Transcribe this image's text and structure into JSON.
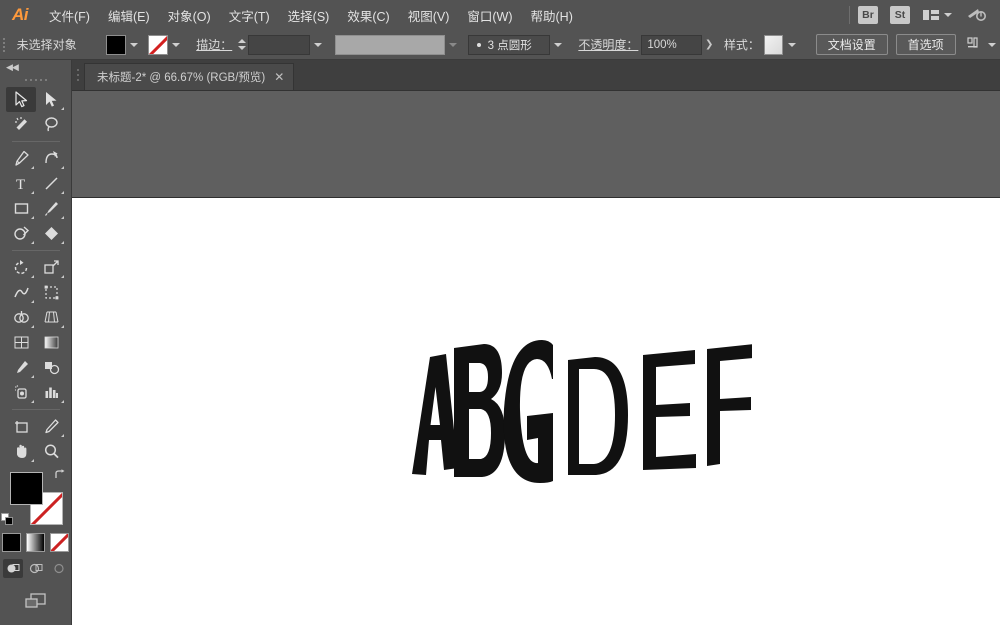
{
  "app": {
    "name": "Adobe Illustrator",
    "logo_text": "Ai"
  },
  "menubar": {
    "items": [
      {
        "label": "文件(F)"
      },
      {
        "label": "编辑(E)"
      },
      {
        "label": "对象(O)"
      },
      {
        "label": "文字(T)"
      },
      {
        "label": "选择(S)"
      },
      {
        "label": "效果(C)"
      },
      {
        "label": "视图(V)"
      },
      {
        "label": "窗口(W)"
      },
      {
        "label": "帮助(H)"
      }
    ],
    "bridge_badge": "Br",
    "stock_badge": "St",
    "workspace_icon": "workspace-switcher-icon",
    "search_icon": "search-adobe-icon"
  },
  "controlbar": {
    "selection_status": "未选择对象",
    "fill_swatch_color": "#000000",
    "stroke_swatch_label": "无",
    "stroke_label": "描边：",
    "stroke_weight_value": "",
    "brush_definition_value": "",
    "brush_profile_label": "3 点圆形",
    "opacity_label": "不透明度：",
    "opacity_value": "100%",
    "style_label": "样式：",
    "document_setup_button": "文档设置",
    "preferences_button": "首选项",
    "align_icon": "align-objects-icon"
  },
  "tabbar": {
    "tabs": [
      {
        "title": "未标题-2* @ 66.67% (RGB/预览)",
        "close": "✕",
        "active": true
      }
    ]
  },
  "toolbar": {
    "collapse_label": "◀◀",
    "tools": [
      {
        "name": "selection-tool",
        "label": "选择工具",
        "active": true,
        "has_flyout": false
      },
      {
        "name": "direct-selection-tool",
        "label": "直接选择工具",
        "active": false,
        "has_flyout": true
      },
      {
        "name": "magic-wand-tool",
        "label": "魔棒工具",
        "active": false,
        "has_flyout": false
      },
      {
        "name": "lasso-tool",
        "label": "套索工具",
        "active": false,
        "has_flyout": false
      },
      {
        "name": "pen-tool",
        "label": "钢笔工具",
        "active": false,
        "has_flyout": true
      },
      {
        "name": "curvature-tool",
        "label": "曲率工具",
        "active": false,
        "has_flyout": true
      },
      {
        "name": "type-tool",
        "label": "文字工具",
        "active": false,
        "has_flyout": true
      },
      {
        "name": "line-segment-tool",
        "label": "直线段工具",
        "active": false,
        "has_flyout": true
      },
      {
        "name": "rectangle-tool",
        "label": "矩形工具",
        "active": false,
        "has_flyout": true
      },
      {
        "name": "paintbrush-tool",
        "label": "画笔工具",
        "active": false,
        "has_flyout": true
      },
      {
        "name": "shaper-pencil-tool",
        "label": "Shaper 工具",
        "active": false,
        "has_flyout": true
      },
      {
        "name": "eraser-tool",
        "label": "橡皮擦工具",
        "active": false,
        "has_flyout": true
      },
      {
        "name": "rotate-tool",
        "label": "旋转工具",
        "active": false,
        "has_flyout": true
      },
      {
        "name": "scale-tool",
        "label": "比例缩放工具",
        "active": false,
        "has_flyout": true
      },
      {
        "name": "width-tool",
        "label": "宽度工具",
        "active": false,
        "has_flyout": true
      },
      {
        "name": "free-transform-tool",
        "label": "自由变换工具",
        "active": false,
        "has_flyout": false
      },
      {
        "name": "shape-builder-tool",
        "label": "形状生成器工具",
        "active": false,
        "has_flyout": true
      },
      {
        "name": "perspective-grid-tool",
        "label": "透视网格工具",
        "active": false,
        "has_flyout": true
      },
      {
        "name": "mesh-tool",
        "label": "网格工具",
        "active": false,
        "has_flyout": false
      },
      {
        "name": "gradient-tool",
        "label": "渐变工具",
        "active": false,
        "has_flyout": false
      },
      {
        "name": "eyedropper-tool",
        "label": "吸管工具",
        "active": false,
        "has_flyout": true
      },
      {
        "name": "blend-tool",
        "label": "混合工具",
        "active": false,
        "has_flyout": false
      },
      {
        "name": "symbol-sprayer-tool",
        "label": "符号喷枪工具",
        "active": false,
        "has_flyout": true
      },
      {
        "name": "column-graph-tool",
        "label": "柱形图工具",
        "active": false,
        "has_flyout": true
      },
      {
        "name": "artboard-tool",
        "label": "画板工具",
        "active": false,
        "has_flyout": false
      },
      {
        "name": "slice-tool",
        "label": "切片工具",
        "active": false,
        "has_flyout": true
      },
      {
        "name": "hand-tool",
        "label": "抓手工具",
        "active": false,
        "has_flyout": true
      },
      {
        "name": "zoom-tool",
        "label": "缩放工具",
        "active": false,
        "has_flyout": false
      }
    ],
    "fill_color": "#000000",
    "stroke_color": "无",
    "color_modes": [
      {
        "name": "color-mode-solid",
        "label": "颜色"
      },
      {
        "name": "color-mode-gradient",
        "label": "渐变"
      },
      {
        "name": "color-mode-none",
        "label": "无"
      }
    ],
    "draw_modes": [
      {
        "name": "draw-normal-mode",
        "label": "正常绘图",
        "active": true
      },
      {
        "name": "draw-behind-mode",
        "label": "背面绘图",
        "active": false
      },
      {
        "name": "draw-inside-mode",
        "label": "内部绘图",
        "active": false
      }
    ],
    "screen_mode": "更改屏幕模式"
  },
  "canvas": {
    "zoom": "66.67%",
    "artwork_text": "ABCDEF",
    "artwork_fill": "#111111",
    "artwork_description": "封套扭曲文字 ABCDEF"
  }
}
